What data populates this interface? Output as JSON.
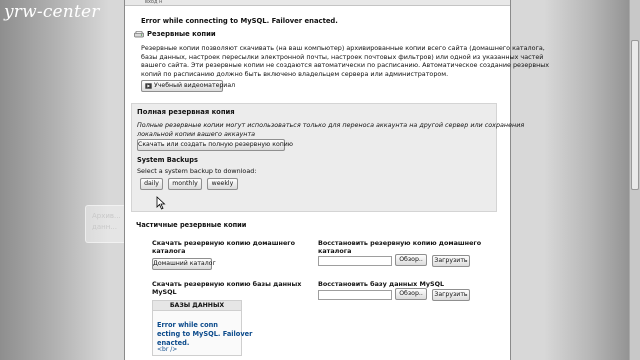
{
  "watermark": "yrw-center",
  "panel": {
    "header_label": "вход н",
    "error_message": "Error while connecting to MySQL. Failover enacted.",
    "backups_title": "Резервные копии",
    "backups_desc": [
      "Резервные копии позволяют скачивать (на ваш компьютер) архивированные копии всего сайта (домашнего каталога,",
      "базы данных, настроек пересылки электронной почты, настроек почтовых фильтров) или одной из указанных частей",
      "вашего сайта. Эти резервные копии не создаются автоматически по расписанию. Автоматическое создание резервных",
      "копий по расписанию должно быть включено владельцем сервера или администратором."
    ],
    "video_button": "Учебный видеоматериал",
    "full_backup": {
      "title": "Полная резервная копия",
      "desc": [
        "Полные резервные копии могут использоваться только для переноса аккаунта на другой сервер или сохранения",
        "локальной копии вашего аккаунта"
      ],
      "button": "Скачать или создать полную резервную копию"
    },
    "system_backups": {
      "title": "System Backups",
      "prompt": "Select a system backup to download:",
      "buttons": [
        "daily",
        "monthly",
        "weekly"
      ]
    },
    "partial": {
      "title": "Частичные резервные копии",
      "home_download_label": [
        "Скачать резервную копию домашнего",
        "каталога"
      ],
      "home_button": "Домашний каталог",
      "home_restore_label": [
        "Восстановить резервную копию домашнего",
        "каталога"
      ],
      "browse": "Обзор..",
      "upload": "Загрузить",
      "db_download_label": [
        "Скачать резервную копию базы данных",
        "MySQL"
      ],
      "db_restore_label": "Восстановить базу данных MySQL",
      "db_box": {
        "header": "БАЗЫ ДАННЫХ",
        "error_lines": [
          "Error while conn",
          "ecting to MySQL. Failover",
          "enacted."
        ],
        "br": "<br />"
      }
    }
  },
  "ghost_tooltip": [
    "Архив...",
    "данн..."
  ]
}
